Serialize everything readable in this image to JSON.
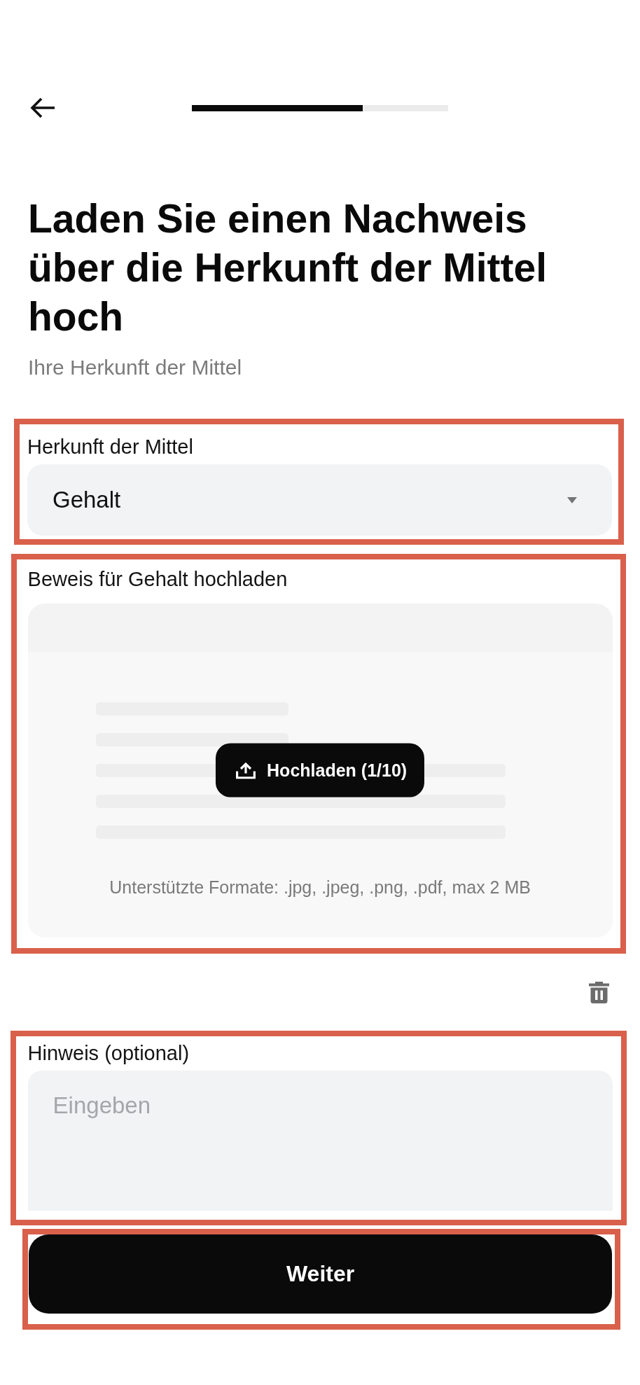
{
  "progress": {
    "level": 0.667
  },
  "title": "Laden Sie einen Nachweis über die Herkunft der Mittel hoch",
  "subtitle": "Ihre Herkunft der Mittel",
  "source_of_funds": {
    "highlighted": true,
    "label": "Herkunft der Mittel",
    "value": "Gehalt"
  },
  "proof_upload": {
    "highlighted": true,
    "label": "Beweis für Gehalt hochladen",
    "button": "Hochladen (1/10)",
    "formats": "Unterstützte Formate: .jpg, .jpeg, .png, .pdf, max 2 MB"
  },
  "note": {
    "highlighted": true,
    "label": "Hinweis (optional)",
    "placeholder": "Eingeben"
  },
  "continue_button": {
    "highlighted": true,
    "label": "Weiter"
  }
}
